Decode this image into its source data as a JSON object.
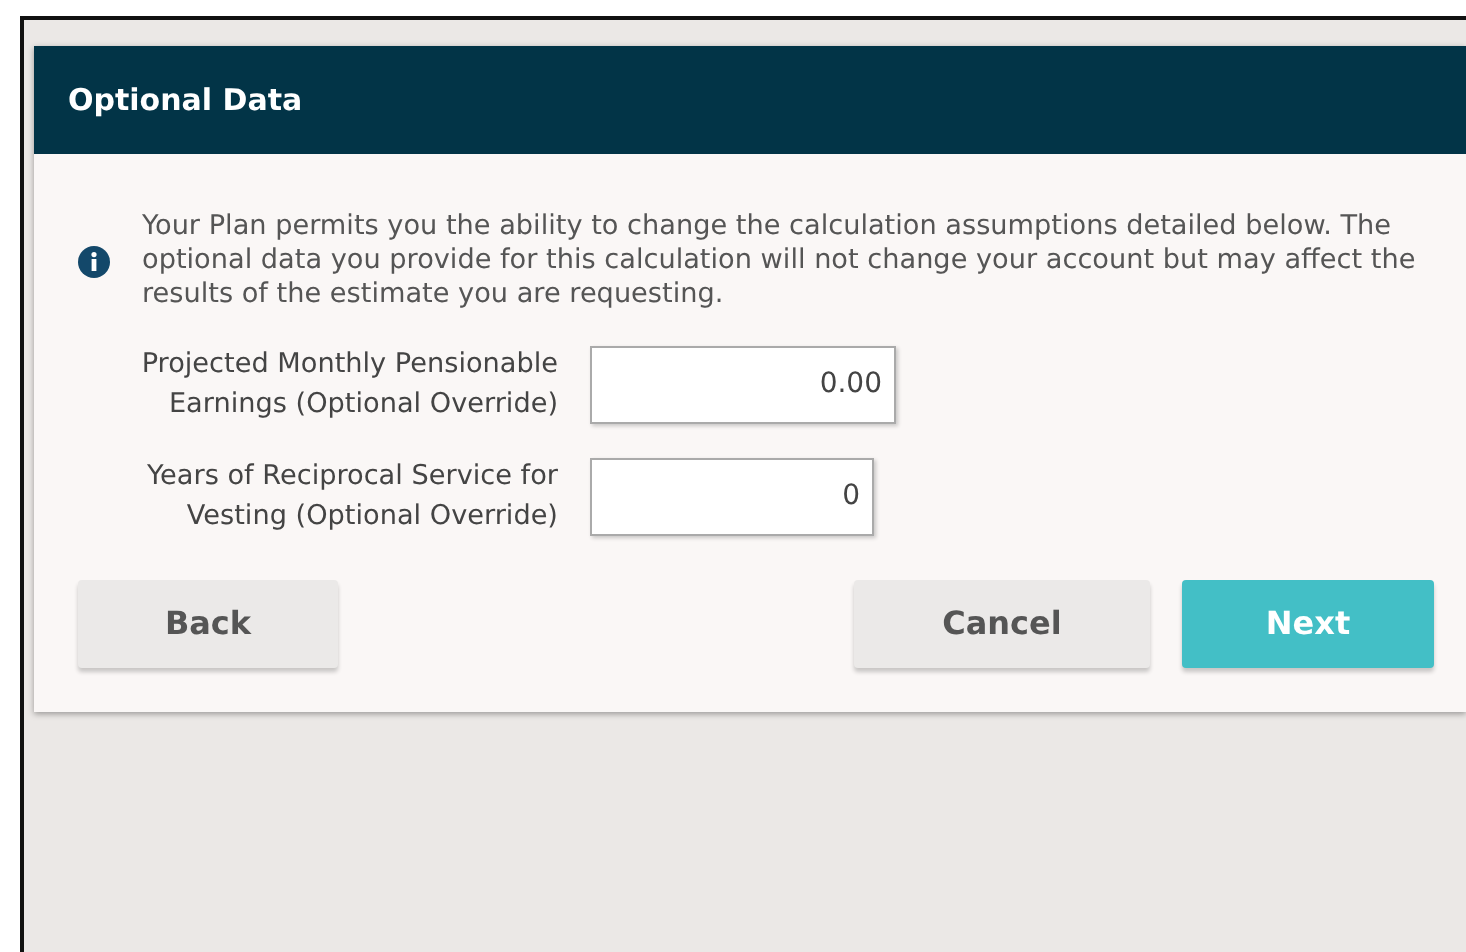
{
  "panel": {
    "title": "Optional Data"
  },
  "notice": {
    "text": "Your Plan permits you the ability to change the calculation assumptions detailed below. The optional data you provide for this calculation will not change your account but may affect the results of the estimate you are requesting."
  },
  "fields": [
    {
      "label": "Projected Monthly Pensionable Earnings (Optional Override)",
      "value": "0.00"
    },
    {
      "label": "Years of Reciprocal Service for Vesting (Optional Override)",
      "value": "0"
    }
  ],
  "left_buttons": [
    {
      "label": "Back",
      "kind": "default"
    }
  ],
  "right_buttons": [
    {
      "label": "Cancel",
      "kind": "default"
    },
    {
      "label": "Next",
      "kind": "primary"
    }
  ]
}
